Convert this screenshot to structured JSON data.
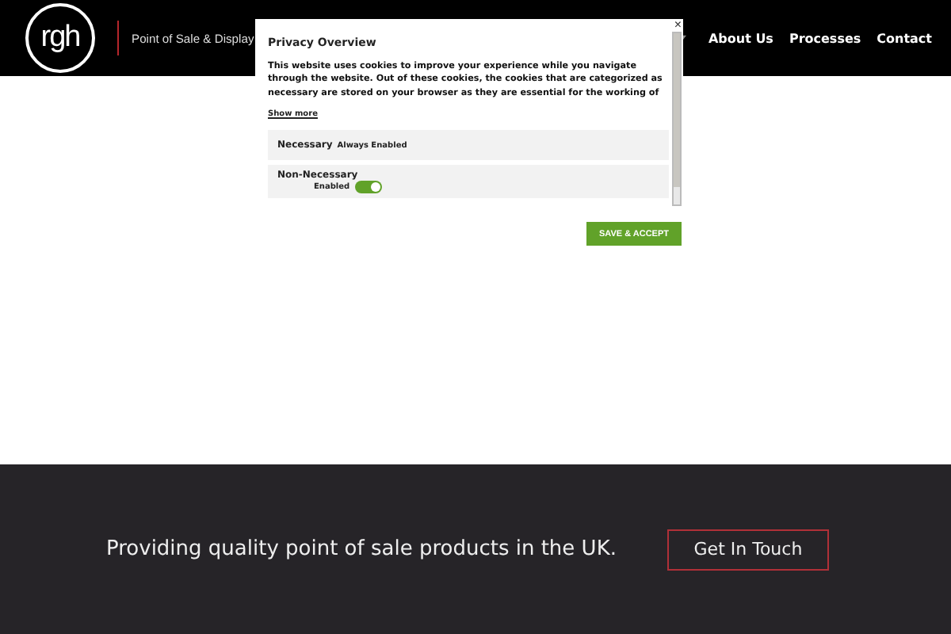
{
  "header": {
    "logo": "rgh",
    "tagline": "Point of Sale & Display",
    "nav": [
      {
        "label": "About Us"
      },
      {
        "label": "Processes"
      },
      {
        "label": "Contact"
      }
    ]
  },
  "privacy_dialog": {
    "title": "Privacy Overview",
    "body": "This website uses cookies to improve your experience while you navigate through the website. Out of these cookies, the cookies that are categorized as necessary are stored on your browser as they are essential for the working of",
    "show_more": "Show more",
    "close": "×",
    "categories": [
      {
        "kind": "fixed",
        "name": "Necessary",
        "status": "Always Enabled"
      },
      {
        "kind": "toggle",
        "name": "Non-Necessary",
        "status": "Enabled",
        "on": true
      }
    ],
    "save_button": "SAVE & ACCEPT"
  },
  "footer": {
    "text": "Providing quality point of sale products in the UK.",
    "button": "Get In Touch"
  }
}
